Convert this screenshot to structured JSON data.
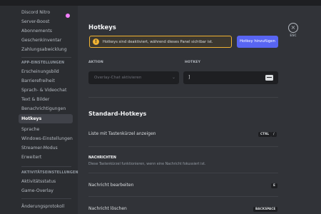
{
  "sidebar": {
    "items_top": [
      {
        "label": "Discord Nitro"
      },
      {
        "label": "Server-Boost"
      },
      {
        "label": "Abonnements"
      },
      {
        "label": "Geschenkinventar"
      },
      {
        "label": "Zahlungsabwicklung"
      }
    ],
    "app_header": "APP-EINSTELLUNGEN",
    "app_items": [
      {
        "label": "Erscheinungsbild"
      },
      {
        "label": "Barrierefreiheit"
      },
      {
        "label": "Sprach- & Videochat"
      },
      {
        "label": "Text & Bilder"
      },
      {
        "label": "Benachrichtigungen"
      },
      {
        "label": "Hotkeys",
        "selected": true
      },
      {
        "label": "Sprache"
      },
      {
        "label": "Windows-Einstellungen"
      },
      {
        "label": "Streamer-Modus"
      },
      {
        "label": "Erweitert"
      }
    ],
    "activity_header": "AKTIVITÄTSEINSTELLUNGEN",
    "activity_items": [
      {
        "label": "Aktivitätsstatus"
      },
      {
        "label": "Game-Overlay"
      }
    ],
    "changelog": "Änderungsprotokoll"
  },
  "main": {
    "title": "Hotkeys",
    "warning": "Hotkeys sind deaktiviert, während dieses Panel sichtbar ist.",
    "add_button": "Hotkey hinzufügen",
    "action_label": "AKTION",
    "action_value": "Overlay-Chat aktivieren",
    "hotkey_label": "HOTKEY",
    "hotkey_value": "]",
    "standard_title": "Standard-Hotkeys",
    "rows": [
      {
        "label": "Liste mit Tastenkürzel anzeigen",
        "keys": [
          "CTRL",
          "/"
        ]
      }
    ],
    "section_header": "NACHRICHTEN",
    "section_desc": "Diese Tastenkürzel funktionieren, wenn eine Nachricht fokussiert ist.",
    "msg_rows": [
      {
        "label": "Nachricht bearbeiten",
        "key": "E"
      },
      {
        "label": "Nachricht löschen",
        "key": "BACKSPACE"
      }
    ]
  },
  "close": {
    "symbol": "×",
    "esc_label": "ESC"
  },
  "colors": {
    "accent": "#5865f2",
    "warning": "#f0b232",
    "background": "#313338",
    "sidebar": "#2b2d31"
  }
}
